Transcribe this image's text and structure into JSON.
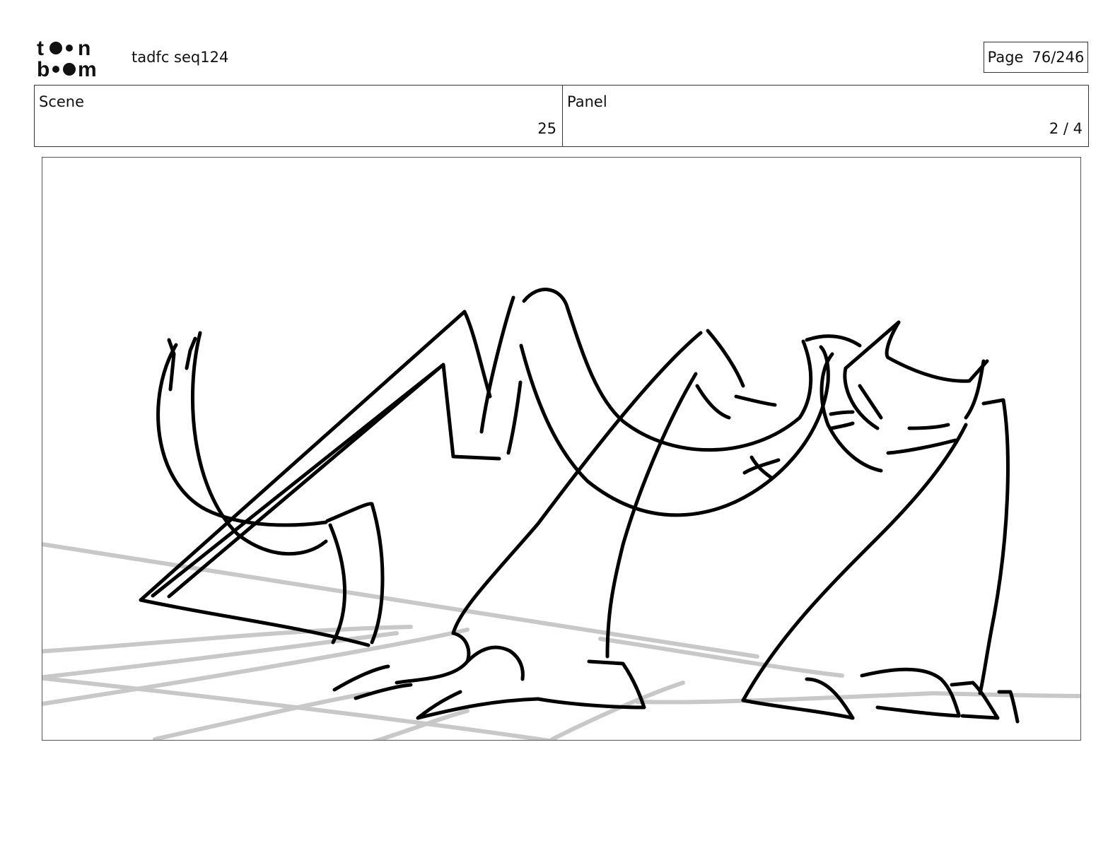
{
  "header": {
    "logo_text": "toon boom",
    "document_title": "tadfc seq124",
    "page_label": "Page",
    "page_value": "76/246"
  },
  "info": {
    "scene_label": "Scene",
    "scene_value": "25",
    "panel_label": "Panel",
    "panel_value": "2 / 4"
  },
  "panel_image": {
    "icon": "storyboard-sketch",
    "stroke_color": "#000000",
    "guide_color": "#c8c8c8"
  }
}
